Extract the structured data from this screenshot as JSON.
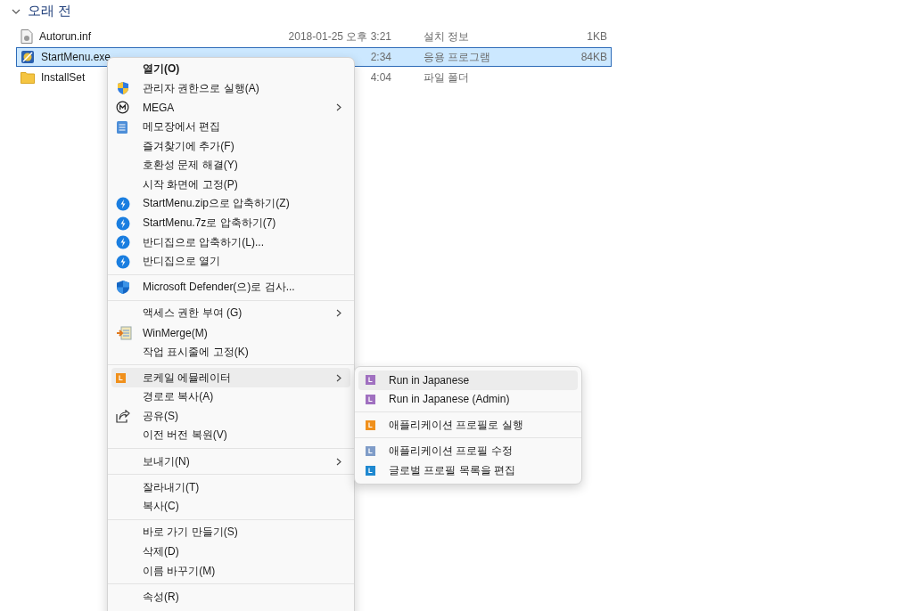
{
  "group": {
    "title": "오래 전",
    "expanded": true
  },
  "files": [
    {
      "kind": "file",
      "name": "Autorun.inf",
      "date": "2018-01-25 오후 3:21",
      "type": "설치 정보",
      "size": "1KB",
      "selected": false
    },
    {
      "kind": "app",
      "name": "StartMenu.exe",
      "date": "2:34",
      "type": "응용 프로그램",
      "size": "84KB",
      "selected": true
    },
    {
      "kind": "folder",
      "name": "InstallSet",
      "date": "4:04",
      "type": "파일 폴더",
      "selected": false
    }
  ],
  "context_menu": [
    {
      "kind": "default",
      "label": "열기(O)",
      "submenu": false,
      "selected": false
    },
    {
      "kind": "uac",
      "label": "관리자 권한으로 실행(A)",
      "submenu": false,
      "selected": false
    },
    {
      "kind": "mega",
      "label": "MEGA",
      "submenu": true,
      "selected": false
    },
    {
      "kind": "notepad",
      "label": "메모장에서 편집",
      "submenu": false,
      "selected": false
    },
    {
      "kind": "plain",
      "label": "즐겨찾기에 추가(F)",
      "submenu": false,
      "selected": false
    },
    {
      "kind": "plain",
      "label": "호환성 문제 해결(Y)",
      "submenu": false,
      "selected": false
    },
    {
      "kind": "plain",
      "label": "시작 화면에 고정(P)",
      "submenu": false,
      "selected": false
    },
    {
      "kind": "bandizip",
      "label": "StartMenu.zip으로 압축하기(Z)",
      "submenu": false,
      "selected": false
    },
    {
      "kind": "bandizip",
      "label": "StartMenu.7z로 압축하기(7)",
      "submenu": false,
      "selected": false
    },
    {
      "kind": "bandizip",
      "label": "반디집으로 압축하기(L)...",
      "submenu": false,
      "selected": false
    },
    {
      "kind": "bandizip",
      "label": "반디집으로 열기",
      "submenu": false,
      "selected": false
    },
    {
      "kind": "separator"
    },
    {
      "kind": "defender",
      "label": "Microsoft Defender(으)로 검사...",
      "submenu": false,
      "selected": false
    },
    {
      "kind": "separator"
    },
    {
      "kind": "plain",
      "label": "액세스 권한 부여 (G)",
      "submenu": true,
      "selected": false
    },
    {
      "kind": "winmerge",
      "label": "WinMerge(M)",
      "submenu": false,
      "selected": false
    },
    {
      "kind": "plain",
      "label": "작업 표시줄에 고정(K)",
      "submenu": false,
      "selected": false
    },
    {
      "kind": "separator"
    },
    {
      "kind": "locale",
      "label": "로케일 에뮬레이터",
      "submenu": true,
      "selected": true
    },
    {
      "kind": "plain",
      "label": "경로로 복사(A)",
      "submenu": false,
      "selected": false
    },
    {
      "kind": "share",
      "label": "공유(S)",
      "submenu": false,
      "selected": false
    },
    {
      "kind": "plain",
      "label": "이전 버전 복원(V)",
      "submenu": false,
      "selected": false
    },
    {
      "kind": "separator"
    },
    {
      "kind": "plain",
      "label": "보내기(N)",
      "submenu": true,
      "selected": false
    },
    {
      "kind": "separator"
    },
    {
      "kind": "plain",
      "label": "잘라내기(T)",
      "submenu": false,
      "selected": false
    },
    {
      "kind": "plain",
      "label": "복사(C)",
      "submenu": false,
      "selected": false
    },
    {
      "kind": "separator"
    },
    {
      "kind": "plain",
      "label": "바로 가기 만들기(S)",
      "submenu": false,
      "selected": false
    },
    {
      "kind": "plain",
      "label": "삭제(D)",
      "submenu": false,
      "selected": false
    },
    {
      "kind": "plain",
      "label": "이름 바꾸기(M)",
      "submenu": false,
      "selected": false
    },
    {
      "kind": "separator"
    },
    {
      "kind": "plain",
      "label": "속성(R)",
      "submenu": false,
      "selected": false
    }
  ],
  "submenu": [
    {
      "kind": "item",
      "label": "Run in Japanese",
      "color": "#a070c0",
      "selected": true
    },
    {
      "kind": "item",
      "label": "Run in Japanese (Admin)",
      "color": "#a070c0",
      "selected": false
    },
    {
      "kind": "separator"
    },
    {
      "kind": "item",
      "label": "애플리케이션 프로필로 실행",
      "color": "#f0901c",
      "selected": false
    },
    {
      "kind": "separator"
    },
    {
      "kind": "item",
      "label": "애플리케이션 프로필 수정",
      "color": "#7f9cc8",
      "selected": false
    },
    {
      "kind": "item",
      "label": "글로벌 프로필 목록을 편집",
      "color": "#1e88d0",
      "selected": false
    }
  ]
}
